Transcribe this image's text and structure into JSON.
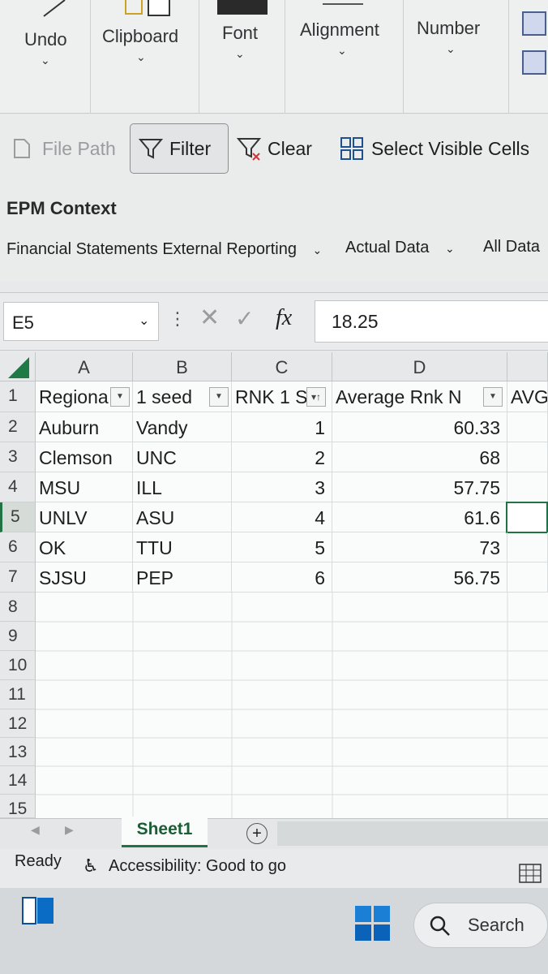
{
  "ribbon": {
    "groups": [
      "Undo",
      "Clipboard",
      "Font",
      "Alignment",
      "Number"
    ]
  },
  "toolbar": {
    "file_path": "File Path",
    "filter": "Filter",
    "clear": "Clear",
    "select_visible": "Select Visible Cells"
  },
  "epm": {
    "title": "EPM Context",
    "dropdowns": [
      "Financial Statements External Reporting",
      "Actual Data",
      "All Data"
    ]
  },
  "formula_bar": {
    "name_box": "E5",
    "fx": "fx",
    "value": "18.25"
  },
  "grid": {
    "columns": [
      "A",
      "B",
      "C",
      "D",
      "AVG"
    ],
    "rows": [
      "1",
      "2",
      "3",
      "4",
      "5",
      "6",
      "7",
      "8",
      "9",
      "10",
      "11",
      "12",
      "13",
      "14",
      "15"
    ],
    "headers": [
      "Regiona",
      "1 seed",
      "RNK 1 S",
      "Average Rnk N",
      "AVG"
    ],
    "data": [
      [
        "Auburn",
        "Vandy",
        "1",
        "60.33"
      ],
      [
        "Clemson",
        "UNC",
        "2",
        "68"
      ],
      [
        "MSU",
        "ILL",
        "3",
        "57.75"
      ],
      [
        "UNLV",
        "ASU",
        "4",
        "61.6"
      ],
      [
        "OK",
        "TTU",
        "5",
        "73"
      ],
      [
        "SJSU",
        "PEP",
        "6",
        "56.75"
      ]
    ]
  },
  "sheets": {
    "active": "Sheet1"
  },
  "status": {
    "ready": "Ready",
    "accessibility": "Accessibility: Good to go"
  },
  "taskbar": {
    "search": "Search"
  },
  "colors": {
    "accent": "#217346",
    "taskbar": "#d5d8db",
    "win_blue": "#0a6cc4"
  }
}
